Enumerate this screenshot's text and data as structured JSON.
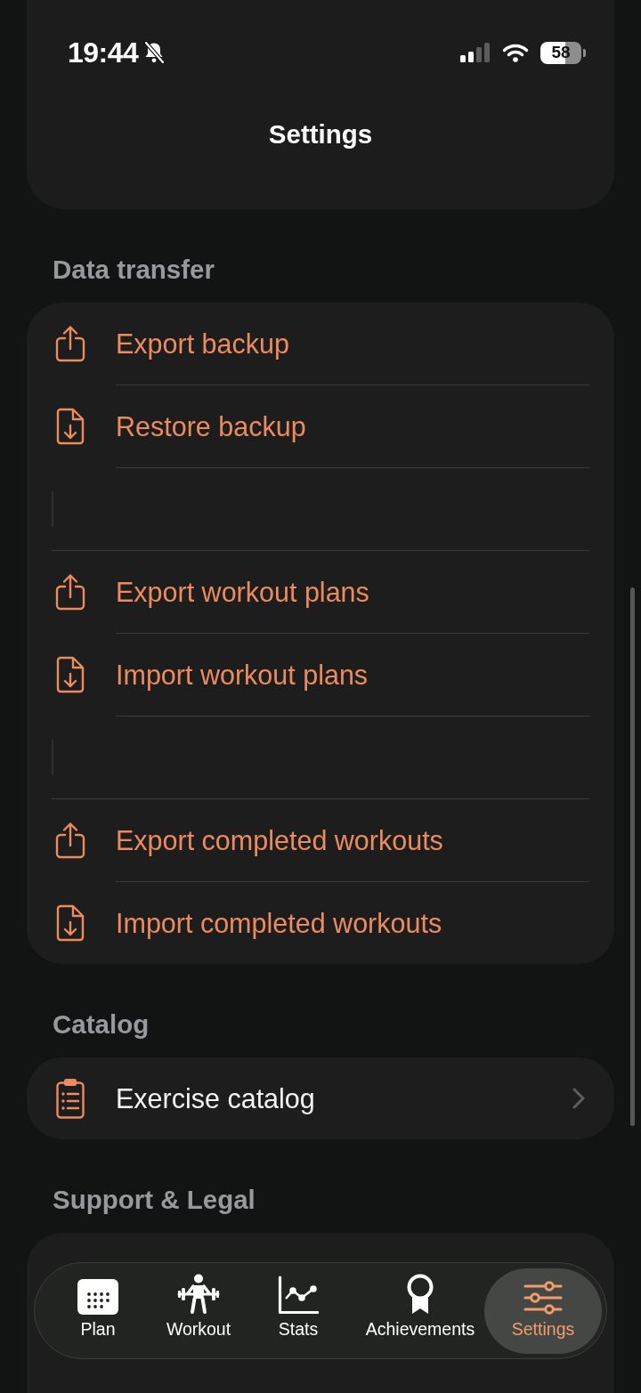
{
  "status_bar": {
    "time": "19:44",
    "silent": true,
    "battery": "58"
  },
  "header": {
    "title": "Settings"
  },
  "sections": [
    {
      "title": "Data transfer",
      "rows": [
        {
          "kind": "export",
          "label": "Export backup"
        },
        {
          "kind": "import",
          "label": "Restore backup"
        },
        {
          "kind": "spacer"
        },
        {
          "kind": "export",
          "label": "Export workout plans"
        },
        {
          "kind": "import",
          "label": "Import workout plans"
        },
        {
          "kind": "spacer"
        },
        {
          "kind": "export",
          "label": "Export completed workouts"
        },
        {
          "kind": "import",
          "label": "Import completed workouts"
        }
      ]
    },
    {
      "title": "Catalog",
      "rows": [
        {
          "kind": "catalog",
          "label": "Exercise catalog"
        }
      ]
    },
    {
      "title": "Support & Legal"
    }
  ],
  "tabs": [
    {
      "kind": "plan",
      "label": "Plan",
      "selected": false
    },
    {
      "kind": "workout",
      "label": "Workout",
      "selected": false
    },
    {
      "kind": "stats",
      "label": "Stats",
      "selected": false
    },
    {
      "kind": "achievements",
      "label": "Achievements",
      "selected": false
    },
    {
      "kind": "settings",
      "label": "Settings",
      "selected": true
    }
  ]
}
